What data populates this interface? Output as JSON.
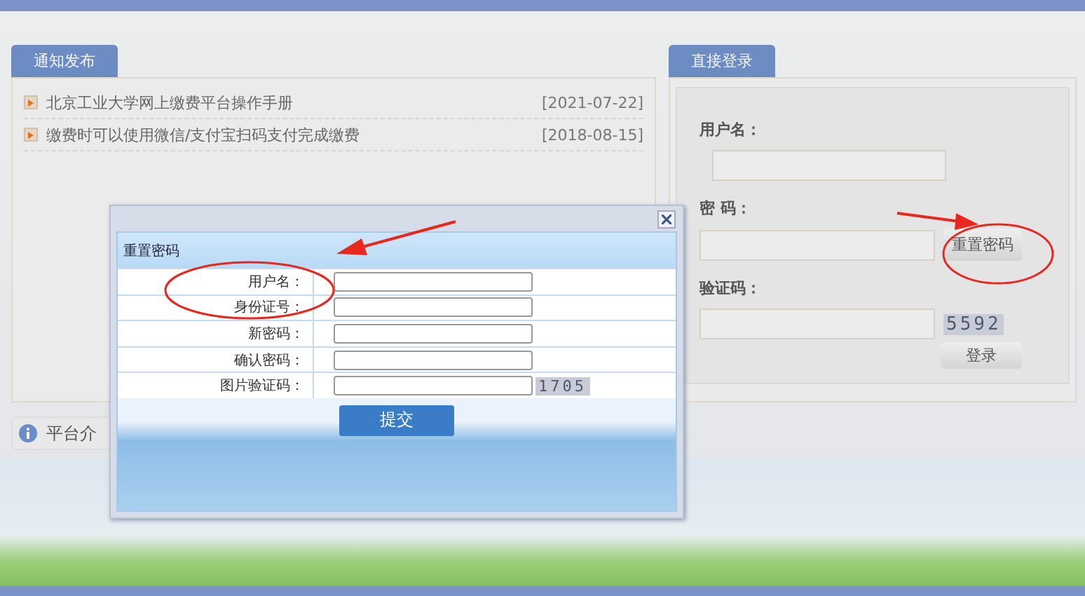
{
  "notices": {
    "tab": "通知发布",
    "items": [
      {
        "title": "北京工业大学网上缴费平台操作手册",
        "date": "[2021-07-22]"
      },
      {
        "title": "缴费时可以使用微信/支付宝扫码支付完成缴费",
        "date": "[2018-08-15]"
      }
    ]
  },
  "login": {
    "tab": "直接登录",
    "fields": [
      {
        "kind": "text",
        "label": "用户名："
      },
      {
        "kind": "password",
        "label": "密 码：",
        "button": "重置密码"
      },
      {
        "kind": "captcha",
        "label": "验证码：",
        "captcha": "5592"
      }
    ],
    "submit": "登录"
  },
  "intro": {
    "title": "平台介"
  },
  "dialog": {
    "title": "重置密码",
    "fields": [
      {
        "label": "用户名："
      },
      {
        "label": "身份证号："
      },
      {
        "label": "新密码："
      },
      {
        "label": "确认密码："
      },
      {
        "label": "图片验证码：",
        "captcha": "1705"
      }
    ],
    "submit": "提交"
  }
}
